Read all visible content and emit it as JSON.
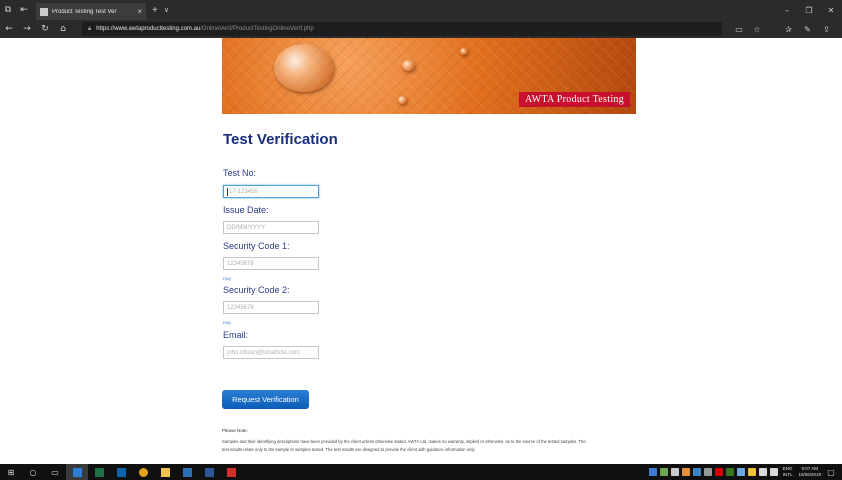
{
  "browser": {
    "tab_title": "Product Testing Test Ver",
    "tab_close": "×",
    "new_tab": "+",
    "tab_menu": "∨",
    "url_host": "https://www.awtaproducttesting.com.au",
    "url_path": "/OnlineVerif/ProductTestingOnlineVerif.php"
  },
  "banner": {
    "brand": "AWTA Product Testing"
  },
  "form": {
    "title": "Test Verification",
    "test_no_label": "Test No:",
    "test_no_placeholder": "17-123456",
    "issue_date_label": "Issue Date:",
    "issue_date_placeholder": "DD/MM/YYYY",
    "security1_label": "Security Code 1:",
    "security1_placeholder": "12345678",
    "faq1": "FAQ",
    "security2_label": "Security Code 2:",
    "security2_placeholder": "12345678",
    "faq2": "FAQ",
    "email_label": "Email:",
    "email_placeholder": "john.citizen@localhost.com",
    "submit": "Request Verification"
  },
  "note": {
    "title": "Please Note:",
    "line1": "Samples and their identifying descriptions have been provided by the client unless otherwise stated. AWTA Ltd. makes no warranty, implied or otherwise, as to the source of the tested samples. The",
    "line2": "test results relate only to the sample or samples tested. The test results are designed to provide the client with guidance information only."
  },
  "taskbar": {
    "lang_top": "ENG",
    "lang_bottom": "INTL",
    "time": "9:07 AM",
    "date": "15/06/2019"
  },
  "colors": {
    "heading": "#1a2e7a",
    "button": "#0b5db7",
    "brand_red": "#c8102e"
  }
}
